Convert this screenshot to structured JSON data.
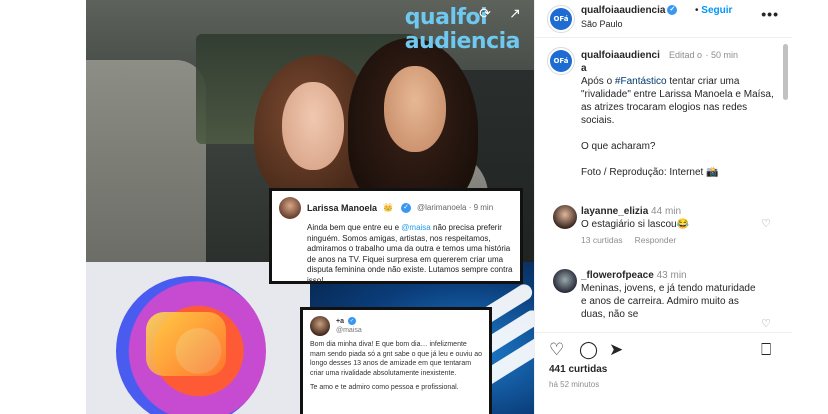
{
  "media": {
    "watermark_line1": "qualfoi",
    "watermark_line2": "audiencia",
    "tweet1": {
      "name": "Larissa Manoela",
      "emoji": "👑",
      "handle": "@larimanoela · 9 min",
      "text_before": "Ainda bem que entre eu e ",
      "mention": "@maisa",
      "text_after": " não precisa preferir ninguém. Somos amigas, artistas, nos respeitamos, admiramos o trabalho uma da outra e temos uma história de anos na TV. Fiquei surpresa em quererem criar uma disputa feminina onde não existe. Lutamos sempre contra isso!"
    },
    "tweet2": {
      "name": "+a",
      "handle": "@maisa",
      "text": "Bom dia minha diva! E que bom dia… infelizmente mam sendo piada só a gnt sabe o que já leu e ouviu ao longo desses 13 anos de amizade em que tentaram criar uma rivalidade absolutamente inexistente.",
      "text2": "Te amo e te admiro como pessoa e profissional."
    }
  },
  "header": {
    "avatar_text": "OFá",
    "username": "qualfoiaaudiencia",
    "follow_label": "Seguir",
    "location": "São Paulo",
    "more_label": "•••"
  },
  "caption": {
    "username": "qualfoiaaudienci a",
    "edited": "Editad o",
    "time": "50 min",
    "text_before": "Após o ",
    "hashtag": "#Fantástico",
    "text_after": " tentar criar uma \"rivalidade\" entre Larissa Manoela e Maísa, as atrizes trocaram elogios nas redes sociais.",
    "question": "O que acharam?",
    "credit": "Foto / Reprodução: Internet 📸"
  },
  "comments": [
    {
      "username": "layanne_elizia",
      "time": "44 min",
      "text": "O estagiário si lascou😂",
      "likes": "13 curtidas",
      "reply_label": "Responder"
    },
    {
      "username": "_flowerofpeace",
      "time": "43 min",
      "text": "Meninas, jovens, e já tendo maturidade e anos de carreira. Admiro muito as duas, não se",
      "likes": "",
      "reply_label": ""
    }
  ],
  "actions": {
    "likes": "441 curtidas",
    "time_ago": "há 52 minutos"
  },
  "colors": {
    "link_blue": "#0095f6",
    "verified_blue": "#3897f0",
    "watermark": "#6ec8f0"
  }
}
